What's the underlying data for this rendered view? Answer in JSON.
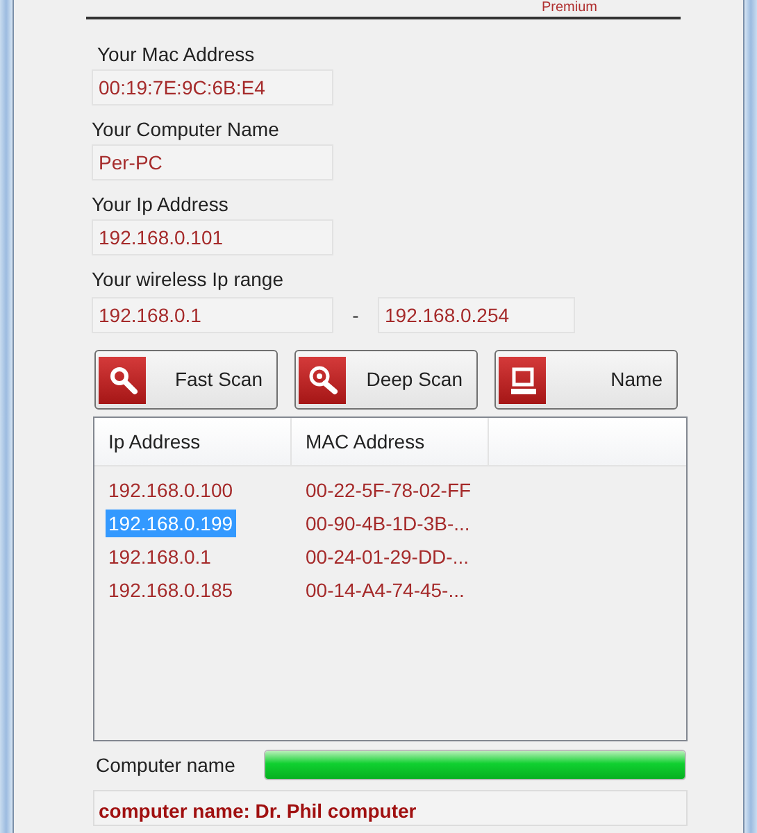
{
  "top_panel": {
    "edition": "Premium"
  },
  "fields": [
    {
      "label": "Your Mac Address",
      "value": "00:19:7E:9C:6B:E4"
    },
    {
      "label": "Your Computer Name",
      "value": "Per-PC"
    },
    {
      "label": "Your Ip Address",
      "value": "192.168.0.101"
    }
  ],
  "range": {
    "label": "Your wireless Ip range",
    "from": "192.168.0.1",
    "separator": "-",
    "to": "192.168.0.254"
  },
  "buttons": [
    {
      "label": "Fast Scan",
      "kind": "search"
    },
    {
      "label": "Deep Scan",
      "kind": "zoom"
    },
    {
      "label": "Name",
      "kind": "computer"
    }
  ],
  "table": {
    "columns": [
      "Ip Address",
      "MAC Address"
    ],
    "rows": [
      {
        "cells": [
          "192.168.0.100",
          "00-22-5F-78-02-FF"
        ],
        "selected": false
      },
      {
        "cells": [
          "192.168.0.199",
          "00-90-4B-1D-3B-..."
        ],
        "selected": true
      },
      {
        "cells": [
          "192.168.0.1",
          "00-24-01-29-DD-..."
        ],
        "selected": false
      },
      {
        "cells": [
          "192.168.0.185",
          "00-14-A4-74-45-..."
        ],
        "selected": false
      }
    ]
  },
  "progress": {
    "label": "Computer name",
    "level": 1
  },
  "result": {
    "value": "computer name: Dr. Phil computer"
  }
}
